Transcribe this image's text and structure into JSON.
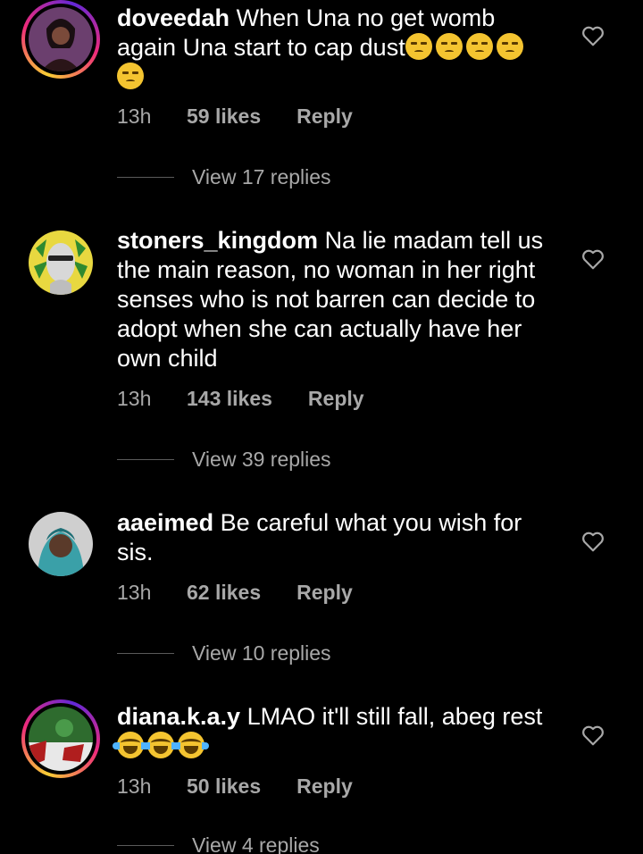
{
  "comments": [
    {
      "username": "doveedah",
      "text": "When Una no get womb again Una start to cap dust",
      "emoji_name": "unamused-face",
      "time": "13h",
      "likes": "59 likes",
      "reply": "Reply",
      "view_replies": "View 17 replies",
      "has_story": true
    },
    {
      "username": "stoners_kingdom",
      "text": "Na lie madam tell us the main reason, no woman in her right senses who is not barren can decide to adopt when she can actually have her own child",
      "time": "13h",
      "likes": "143 likes",
      "reply": "Reply",
      "view_replies": "View 39 replies",
      "has_story": false
    },
    {
      "username": "aaeimed",
      "text": "Be careful what you wish for sis.",
      "time": "13h",
      "likes": "62 likes",
      "reply": "Reply",
      "view_replies": "View 10 replies",
      "has_story": false
    },
    {
      "username": "diana.k.a.y",
      "text": "LMAO it'll still fall, abeg rest",
      "emoji_name": "face-with-tears-of-joy",
      "time": "13h",
      "likes": "50 likes",
      "reply": "Reply",
      "view_replies": "View 4 replies",
      "has_story": true
    }
  ],
  "colors": {
    "background": "#000000",
    "secondary_text": "#a8a8a8",
    "story_ring_start": "#f9ce34",
    "story_ring_mid": "#ee2a7b"
  },
  "icons": {
    "like": "heart-outline-icon"
  }
}
